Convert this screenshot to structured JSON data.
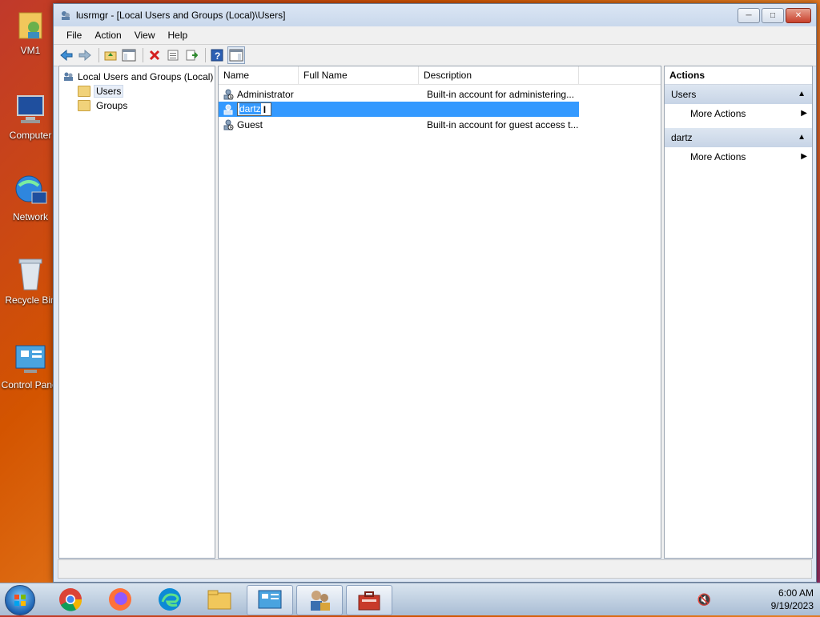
{
  "desktop": {
    "icons": [
      {
        "label": "VM1",
        "icon": "user-folder-icon"
      },
      {
        "label": "Computer",
        "icon": "computer-icon"
      },
      {
        "label": "Network",
        "icon": "network-icon"
      },
      {
        "label": "Recycle Bin",
        "icon": "recycle-bin-icon"
      },
      {
        "label": "Control Panel",
        "icon": "control-panel-icon"
      }
    ]
  },
  "window": {
    "title": "lusrmgr - [Local Users and Groups (Local)\\Users]",
    "minimize_icon": "minimize-icon",
    "maximize_icon": "maximize-icon",
    "close_icon": "close-icon"
  },
  "menu": {
    "file": "File",
    "action": "Action",
    "view": "View",
    "help": "Help"
  },
  "toolbar": {
    "buttons": [
      "back-icon",
      "forward-icon",
      "up-folder-icon",
      "show-hide-tree-icon",
      "delete-icon",
      "properties-icon",
      "export-list-icon",
      "help-icon",
      "show-hide-action-pane-icon"
    ]
  },
  "tree": {
    "root": "Local Users and Groups (Local)",
    "items": [
      {
        "label": "Users",
        "selected": true
      },
      {
        "label": "Groups",
        "selected": false
      }
    ]
  },
  "list": {
    "columns": [
      "Name",
      "Full Name",
      "Description"
    ],
    "rows": [
      {
        "name": "Administrator",
        "full_name": "",
        "description": "Built-in account for administering..."
      },
      {
        "name": "dartz",
        "full_name": "",
        "description": "",
        "editing": true
      },
      {
        "name": "Guest",
        "full_name": "",
        "description": "Built-in account for guest access t..."
      }
    ]
  },
  "actions": {
    "title": "Actions",
    "sections": [
      {
        "header": "Users",
        "items": [
          "More Actions"
        ]
      },
      {
        "header": "dartz",
        "items": [
          "More Actions"
        ]
      }
    ]
  },
  "taskbar": {
    "apps": [
      "chrome-icon",
      "firefox-icon",
      "edge-icon",
      "file-explorer-icon",
      "control-panel-icon",
      "user-accounts-icon",
      "computer-management-icon"
    ],
    "time": "6:00 AM",
    "date": "9/19/2023",
    "tray_icon": "volume-muted-icon"
  },
  "colors": {
    "selection": "#3399ff",
    "accent": "#1b5fb0"
  }
}
